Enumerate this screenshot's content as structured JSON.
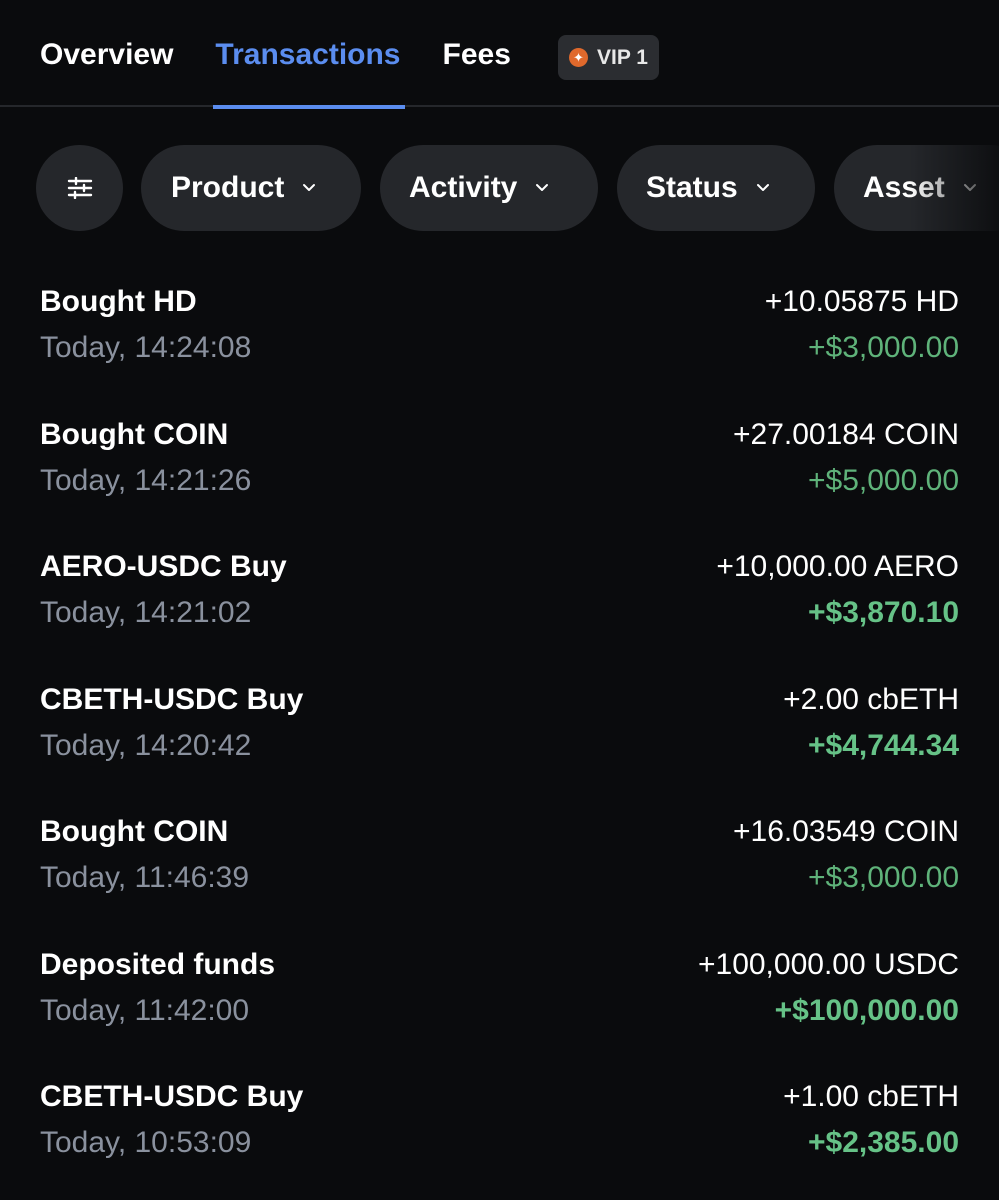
{
  "tabs": [
    {
      "label": "Overview",
      "active": false
    },
    {
      "label": "Transactions",
      "active": true
    },
    {
      "label": "Fees",
      "active": false
    }
  ],
  "vip_badge": {
    "label": "VIP 1",
    "accent": "#e0692c"
  },
  "filters": {
    "icon": "sliders-icon",
    "pills": [
      "Product",
      "Activity",
      "Status",
      "Asset"
    ]
  },
  "colors": {
    "background": "#0a0b0d",
    "active_tab": "#5b8def",
    "positive": "#5fb37a",
    "secondary_text": "#8a919e",
    "pill_bg": "#25272b"
  },
  "transactions": [
    {
      "title": "Bought HD",
      "time": "Today, 14:24:08",
      "amount": "+10.05875 HD",
      "fiat": "+$3,000.00",
      "fiat_bold": false
    },
    {
      "title": "Bought COIN",
      "time": "Today, 14:21:26",
      "amount": "+27.00184 COIN",
      "fiat": "+$5,000.00",
      "fiat_bold": false
    },
    {
      "title": "AERO-USDC Buy",
      "time": "Today, 14:21:02",
      "amount": "+10,000.00 AERO",
      "fiat": "+$3,870.10",
      "fiat_bold": true
    },
    {
      "title": "CBETH-USDC Buy",
      "time": "Today, 14:20:42",
      "amount": "+2.00 cbETH",
      "fiat": "+$4,744.34",
      "fiat_bold": true
    },
    {
      "title": "Bought COIN",
      "time": "Today, 11:46:39",
      "amount": "+16.03549 COIN",
      "fiat": "+$3,000.00",
      "fiat_bold": false
    },
    {
      "title": "Deposited funds",
      "time": "Today, 11:42:00",
      "amount": "+100,000.00 USDC",
      "fiat": "+$100,000.00",
      "fiat_bold": true
    },
    {
      "title": "CBETH-USDC Buy",
      "time": "Today, 10:53:09",
      "amount": "+1.00 cbETH",
      "fiat": "+$2,385.00",
      "fiat_bold": true
    }
  ]
}
